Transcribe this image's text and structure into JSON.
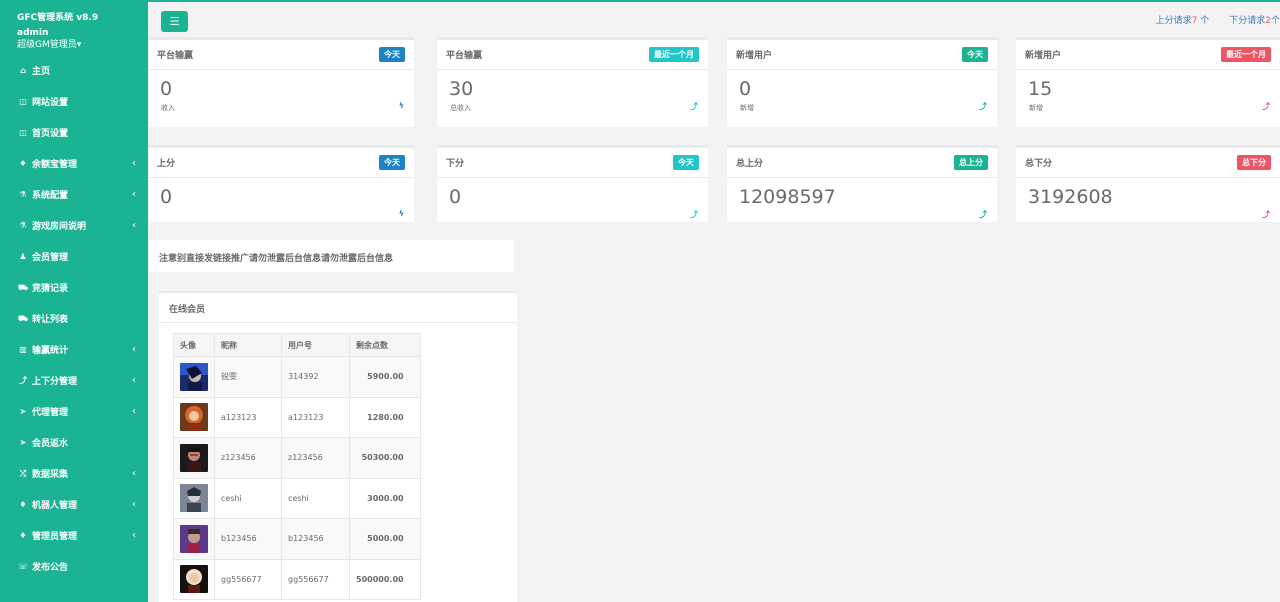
{
  "sidebar": {
    "app_title": "GFC管理系统 v8.9",
    "user": "admin",
    "role": "超级GM管理员",
    "items": [
      {
        "label": "主页",
        "icon": "⌂",
        "chev": false
      },
      {
        "label": "网站设置",
        "icon": "◫",
        "chev": false
      },
      {
        "label": "首页设置",
        "icon": "◫",
        "chev": false
      },
      {
        "label": "余额宝管理",
        "icon": "♦",
        "chev": true
      },
      {
        "label": "系统配置",
        "icon": "⚗",
        "chev": true
      },
      {
        "label": "游戏房间说明",
        "icon": "⚗",
        "chev": true
      },
      {
        "label": "会员管理",
        "icon": "♟",
        "chev": false
      },
      {
        "label": "竞猜记录",
        "icon": "⛟",
        "chev": false
      },
      {
        "label": "转让列表",
        "icon": "⛟",
        "chev": false
      },
      {
        "label": "输赢统计",
        "icon": "▥",
        "chev": true
      },
      {
        "label": "上下分管理",
        "icon": "⤴",
        "chev": true
      },
      {
        "label": "代理管理",
        "icon": "➤",
        "chev": true
      },
      {
        "label": "会员返水",
        "icon": "➤",
        "chev": false
      },
      {
        "label": "数据采集",
        "icon": "⤮",
        "chev": true
      },
      {
        "label": "机器人管理",
        "icon": "♦",
        "chev": true
      },
      {
        "label": "管理员管理",
        "icon": "♦",
        "chev": true
      },
      {
        "label": "发布公告",
        "icon": "☏",
        "chev": false
      }
    ],
    "chevron_glyph": "‹"
  },
  "topbar": {
    "up_requests_label": "上分请求",
    "up_requests_count": "7",
    "up_requests_unit": "个",
    "down_requests_label": "下分请求",
    "down_requests_count": "2",
    "down_requests_unit": "个"
  },
  "cards": [
    {
      "title": "平台输赢",
      "badge": "今天",
      "value": "0",
      "sub": "收入",
      "icon": "ϟ"
    },
    {
      "title": "平台输赢",
      "badge": "最近一个月",
      "value": "30",
      "sub": "总收入",
      "icon": "⤴"
    },
    {
      "title": "新增用户",
      "badge": "今天",
      "value": "0",
      "sub": "新增",
      "icon": "⤴"
    },
    {
      "title": "新增用户",
      "badge": "最近一个月",
      "value": "15",
      "sub": "新增",
      "icon": "⤴"
    },
    {
      "title": "上分",
      "badge": "今天",
      "value": "0",
      "sub": "",
      "icon": "ϟ"
    },
    {
      "title": "下分",
      "badge": "今天",
      "value": "0",
      "sub": "",
      "icon": "⤴"
    },
    {
      "title": "总上分",
      "badge": "总上分",
      "value": "12098597",
      "sub": "",
      "icon": "⤴"
    },
    {
      "title": "总下分",
      "badge": "总下分",
      "value": "3192608",
      "sub": "",
      "icon": "⤴"
    }
  ],
  "colors": {
    "primary": "#1ab394",
    "blue": "#1c84c6",
    "teal": "#23c6c8",
    "red": "#ed5565",
    "link": "#337ab7"
  },
  "notice": "注意别直接发链接推广请勿泄露后台信息请勿泄露后台信息",
  "online": {
    "title": "在线会员",
    "headers": [
      "头像",
      "昵称",
      "用户号",
      "剩余点数"
    ],
    "rows": [
      {
        "nickname": "锐雯",
        "uid": "314392",
        "points": "5900.00"
      },
      {
        "nickname": "a123123",
        "uid": "a123123",
        "points": "1280.00"
      },
      {
        "nickname": "z123456",
        "uid": "z123456",
        "points": "50300.00"
      },
      {
        "nickname": "ceshi",
        "uid": "ceshi",
        "points": "3000.00"
      },
      {
        "nickname": "b123456",
        "uid": "b123456",
        "points": "5000.00"
      },
      {
        "nickname": "gg556677",
        "uid": "gg556677",
        "points": "500000.00"
      }
    ]
  }
}
